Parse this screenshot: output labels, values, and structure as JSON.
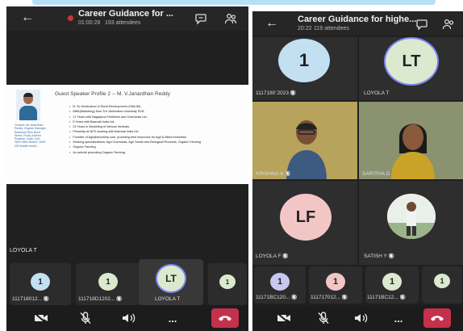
{
  "colors": {
    "teams_bg": "#202020",
    "hangup_red": "#c4314b",
    "rec_red": "#d13438",
    "avatar_lavender": "#c7c8ef",
    "avatar_pink": "#f3c6c6",
    "avatar_green": "#dbe9cf",
    "avatar_blue": "#c3dff2"
  },
  "left": {
    "header": {
      "title": "Career Guidance for ...",
      "timer": "01:00:28",
      "attendees": "193 attendees"
    },
    "slide": {
      "title": "Guest Speaker Profile 2 -- M. V.Janardhan Reddy",
      "contact": "Contact: Mr.Janardhan Reddy, Organic Manager, Rasheedi Rice Bond Street, Rural, Andhra Pradesh, India. Cell: 9849 4800 Nellore, 5000 000 Mobile email:...",
      "bullets": [
        "B. Sc Horticulture & Rural Development (1984-89)",
        "MBA(Marketing) from S.K.Ambedkar University SVN",
        "17 Years with Nagarjuna Fertilizers and Chemicals Ltd.",
        "5 Years with Basmati India Ltd.",
        "22 Years in Marketing of Various Verticals",
        "Presently at NFS working with Basmati India Ltd.",
        "Founder of Agri@doorstep.com, providing best resources for Agri & Allied Industries",
        "Working specializations: Agri Chemicals, Agri Seeds and Biological Products, Organic Farming",
        "Organic Farming",
        "An activist promoting Organic Farming"
      ]
    },
    "presenter_label": "LOYOLA T",
    "strip": [
      {
        "initials": "1",
        "name": "111718012...",
        "muted": true,
        "color_key": "avatar_blue"
      },
      {
        "initials": "1",
        "name": "111718D1202...",
        "muted": true,
        "color_key": "avatar_green"
      },
      {
        "initials": "LT",
        "name": "LOYOLA T",
        "muted": false,
        "active": true
      },
      {
        "initials": "1",
        "name": "",
        "muted": false,
        "color_key": "avatar_green"
      }
    ]
  },
  "right": {
    "header": {
      "title": "Career Guidance for highe...",
      "timer": "20:22",
      "attendees": "119 attendees"
    },
    "grid": [
      {
        "initials": "1",
        "name": "1117180`2023",
        "muted": true
      },
      {
        "initials": "LT",
        "name": "LOYOLA T",
        "muted": false
      },
      {
        "name": "KRISHNA K",
        "muted": true,
        "video": true
      },
      {
        "name": "SARITHA D",
        "muted": false,
        "video": true
      },
      {
        "initials": "LF",
        "name": "LOYOLA F",
        "muted": true
      },
      {
        "name": "SATISH Y",
        "muted": true,
        "video": true
      }
    ],
    "strip": [
      {
        "initials": "1",
        "name": "11171BC120...",
        "muted": true
      },
      {
        "initials": "1",
        "name": "111717012...",
        "muted": true
      },
      {
        "initials": "1",
        "name": "11171BC12...",
        "muted": true
      },
      {
        "initials": "1",
        "name": "",
        "muted": false
      }
    ]
  },
  "controls": {
    "camera": "camera-off-icon",
    "mic": "mic-off-icon",
    "speaker": "speaker-icon",
    "more": "...",
    "hangup": "hang-up-icon"
  }
}
